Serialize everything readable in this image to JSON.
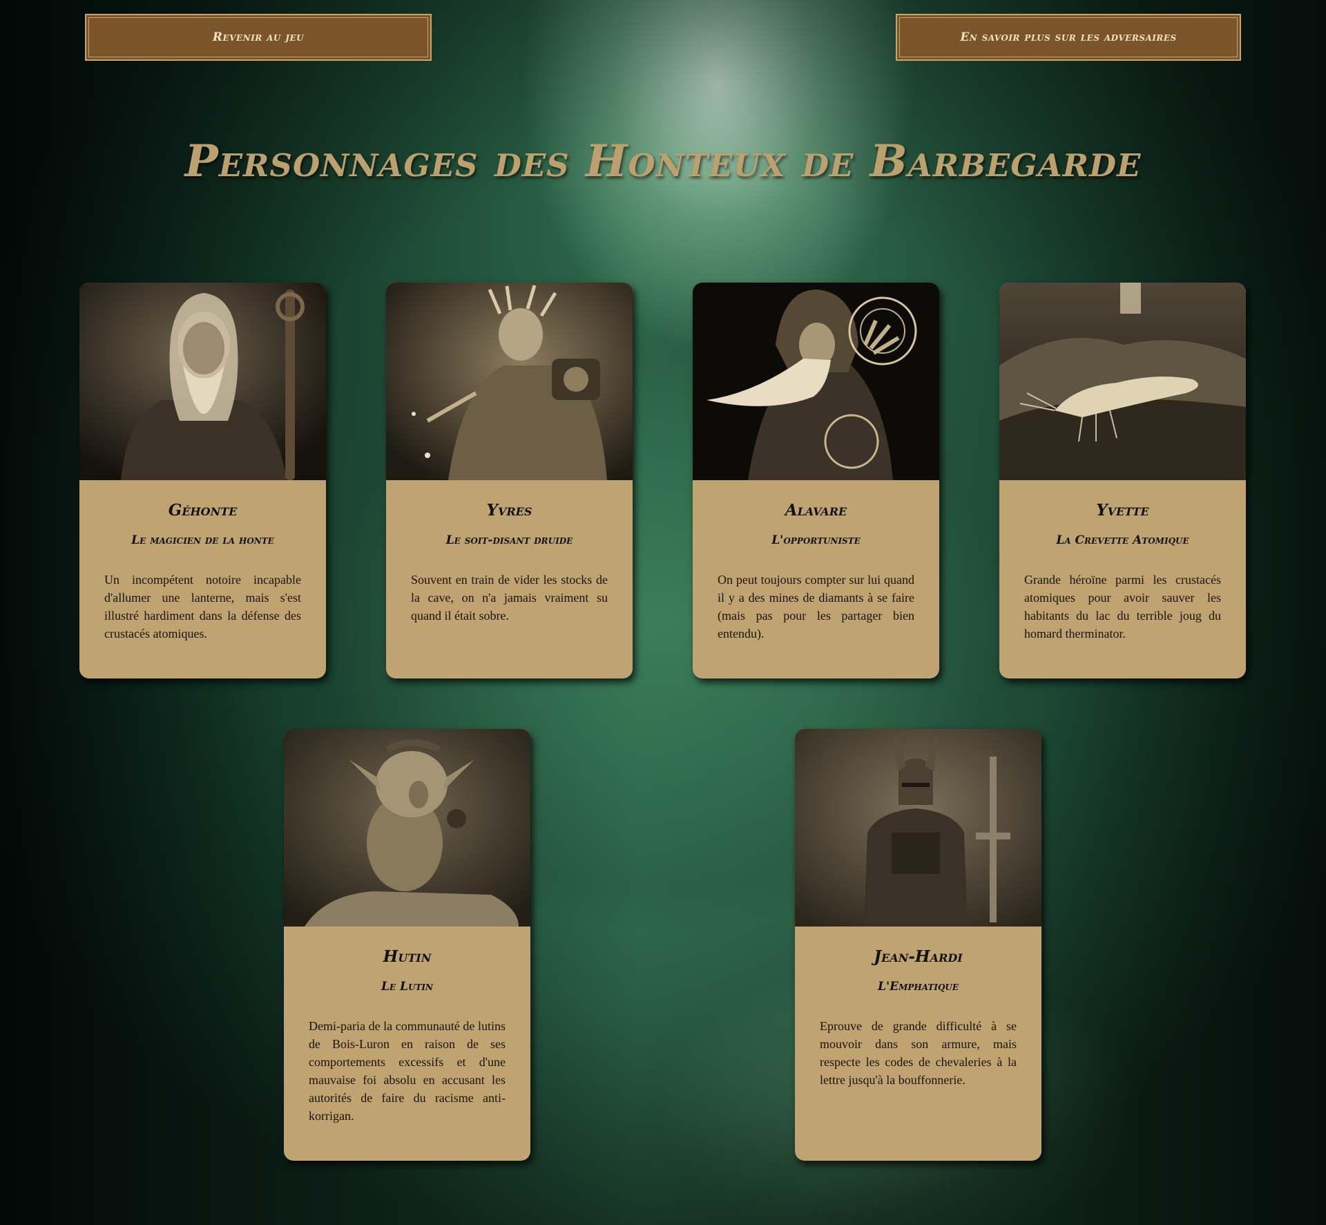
{
  "nav": {
    "back_label": "Revenir au jeu",
    "adversaries_label": "En savoir plus sur les adversaires"
  },
  "page": {
    "title": "Personnages des Honteux de Barbegarde"
  },
  "colors": {
    "card_bg": "#bfa472",
    "button_bg": "#7a552b",
    "button_border": "#c8a46a",
    "title": "#bca16e"
  },
  "characters": [
    {
      "name": "Géhonte",
      "role": "Le magicien de la honte",
      "description": "Un incompétent notoire incapable d'allumer une lanterne, mais s'est illustré hardiment dans la défense des crustacés atomiques.",
      "portrait_icon": "old-wizard-with-staff-portrait"
    },
    {
      "name": "Yvres",
      "role": "Le soit-disant druide",
      "description": "Souvent en train de vider les stocks de la cave, on n'a jamais vraiment su quand il était sobre.",
      "portrait_icon": "druid-with-antler-crown-portrait"
    },
    {
      "name": "Alavare",
      "role": "L'opportuniste",
      "description": "On peut toujours compter sur lui quand il y a des mines de diamants à se faire (mais pas pour les partager bien entendu).",
      "portrait_icon": "hooded-sorcerer-casting-portrait"
    },
    {
      "name": "Yvette",
      "role": "La Crevette Atomique",
      "description": "Grande héroïne parmi les crustacés atomiques pour avoir sauver les habitants du lac du terrible joug du homard therminator.",
      "portrait_icon": "shrimp-in-grass-portrait"
    },
    {
      "name": "Hutin",
      "role": "Le Lutin",
      "description": "Demi-paria de la communauté de lutins de Bois-Luron en raison de ses comportements excessifs et d'une mauvaise foi absolu en accusant les autorités de faire du racisme anti-korrigan.",
      "portrait_icon": "goblin-sitting-portrait"
    },
    {
      "name": "Jean-Hardi",
      "role": "L'Emphatique",
      "description": "Eprouve de grande difficulté à se mouvoir dans son armure, mais respecte les codes de chevaleries à la lettre jusqu'à la bouffonnerie.",
      "portrait_icon": "armored-knight-with-sword-portrait"
    }
  ]
}
